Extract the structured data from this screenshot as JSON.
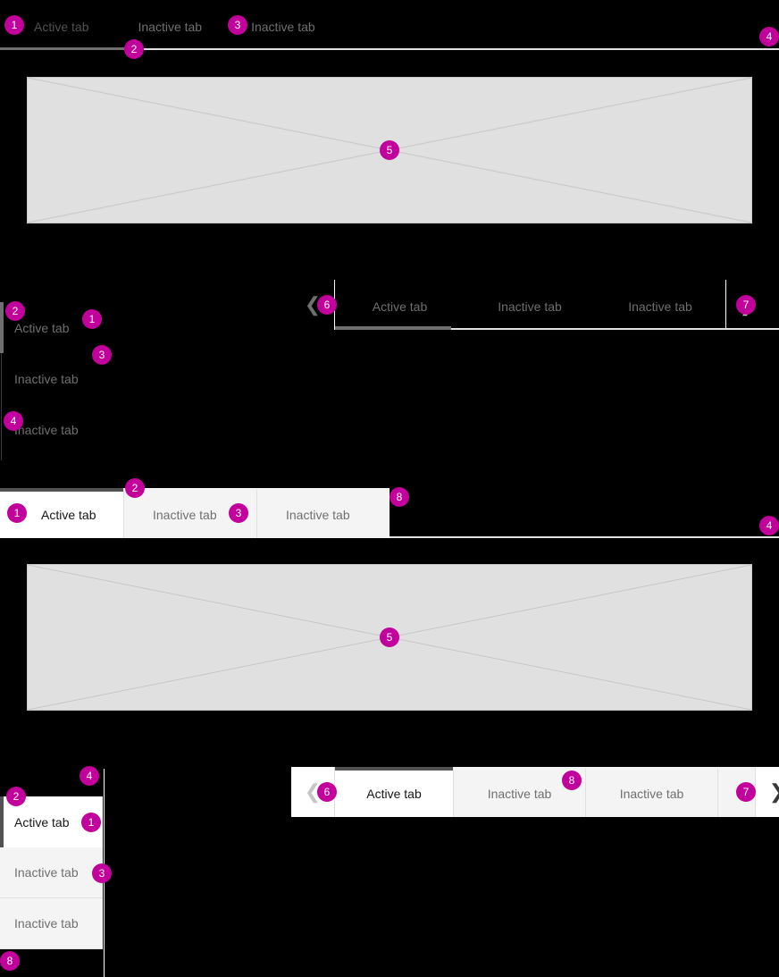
{
  "labels": {
    "active_tab": "Active tab",
    "inactive_tab": "Inactive tab",
    "chevron_left": "❮",
    "chevron_right": "❯"
  },
  "annotations": {
    "n1": "1",
    "n2": "2",
    "n3": "3",
    "n4": "4",
    "n5": "5",
    "n6": "6",
    "n7": "7",
    "n8": "8"
  },
  "colors": {
    "annotation": "#c2009b",
    "active_text": "#161616",
    "inactive_text": "#6f6f6f",
    "active_indicator": "#525252",
    "inactive_bg": "#f4f4f4",
    "active_bg": "#ffffff",
    "border": "#e0e0e0",
    "panel_fill": "#e0e0e0",
    "panel_border": "#c6c6c6",
    "canvas": "#000000"
  },
  "sections": {
    "line_tabs_dark": {
      "tabs": [
        {
          "label": "Active tab",
          "state": "active"
        },
        {
          "label": "Inactive tab",
          "state": "inactive"
        },
        {
          "label": "Inactive tab",
          "state": "inactive"
        }
      ]
    },
    "panel_top": {
      "kind": "content-panel-placeholder"
    },
    "vertical_tabs_dark": {
      "tabs": [
        {
          "label": "Active tab",
          "state": "active"
        },
        {
          "label": "Inactive tab",
          "state": "inactive"
        },
        {
          "label": "Inactive tab",
          "state": "inactive"
        }
      ]
    },
    "scrollable_line_tabs_dark": {
      "prev": "❮",
      "next": "❯",
      "tabs": [
        {
          "label": "Active tab",
          "state": "active"
        },
        {
          "label": "Inactive tab",
          "state": "inactive"
        },
        {
          "label": "Inactive tab",
          "state": "inactive"
        }
      ]
    },
    "contained_tabs_light": {
      "tabs": [
        {
          "label": "Active tab",
          "state": "active"
        },
        {
          "label": "Inactive tab",
          "state": "inactive"
        },
        {
          "label": "Inactive tab",
          "state": "inactive"
        }
      ]
    },
    "panel_bottom": {
      "kind": "content-panel-placeholder"
    },
    "vertical_tabs_light": {
      "tabs": [
        {
          "label": "Active tab",
          "state": "active"
        },
        {
          "label": "Inactive tab",
          "state": "inactive"
        },
        {
          "label": "Inactive tab",
          "state": "inactive"
        }
      ]
    },
    "scrollable_contained_tabs_light": {
      "prev": "❮",
      "next": "❯",
      "tabs": [
        {
          "label": "Active tab",
          "state": "active"
        },
        {
          "label": "Inactive tab",
          "state": "inactive"
        },
        {
          "label": "Inactive tab",
          "state": "inactive"
        }
      ]
    }
  }
}
